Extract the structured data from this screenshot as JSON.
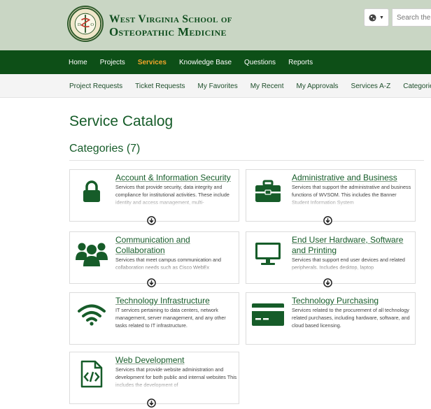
{
  "header": {
    "logo_line1": "West Virginia School of",
    "logo_line2": "Osteopathic Medicine",
    "search_placeholder": "Search the"
  },
  "main_nav": [
    {
      "label": "Home",
      "active": false
    },
    {
      "label": "Projects",
      "active": false
    },
    {
      "label": "Services",
      "active": true
    },
    {
      "label": "Knowledge Base",
      "active": false
    },
    {
      "label": "Questions",
      "active": false
    },
    {
      "label": "Reports",
      "active": false
    }
  ],
  "sub_nav": [
    "Project Requests",
    "Ticket Requests",
    "My Favorites",
    "My Recent",
    "My Approvals",
    "Services A-Z",
    "Categories"
  ],
  "page": {
    "title": "Service Catalog",
    "categories_heading": "Categories (7)"
  },
  "colors": {
    "brand_green": "#0d4f17",
    "header_bg": "#c9d6c4",
    "active_nav": "#f2a52b",
    "link_green": "#165c29"
  },
  "categories": [
    {
      "title": "Account & Information Security",
      "description": "Services that provide security, data integrity and compliance for institutional activities. These include identity and access management, multi-",
      "icon": "lock-icon",
      "truncated": true
    },
    {
      "title": "Administrative and Business",
      "description": "Services that support the administrative and business functions of WVSOM. This includes the Banner Student Information System",
      "icon": "briefcase-icon",
      "truncated": true
    },
    {
      "title": "Communication and Collaboration",
      "description": "Services that meet campus communication and collaboration needs such as Cisco WebEx",
      "icon": "users-icon",
      "truncated": true
    },
    {
      "title": "End User Hardware, Software and Printing",
      "description": "Services that support end user devices and related peripherals. Includes desktop, laptop",
      "icon": "desktop-icon",
      "truncated": true
    },
    {
      "title": "Technology Infrastructure",
      "description": "IT services pertaining to data centers, network management, server management, and any other tasks related to IT infrastructure.",
      "icon": "wifi-icon",
      "truncated": false
    },
    {
      "title": "Technology Purchasing",
      "description": "Services related to the procurement of all technology related purchases, including hardware, software, and cloud based licensing.",
      "icon": "credit-card-icon",
      "truncated": false
    },
    {
      "title": "Web Development",
      "description": "Services that provide website administration and development for both public and internal websites This includes the development of",
      "icon": "code-file-icon",
      "truncated": true
    }
  ]
}
